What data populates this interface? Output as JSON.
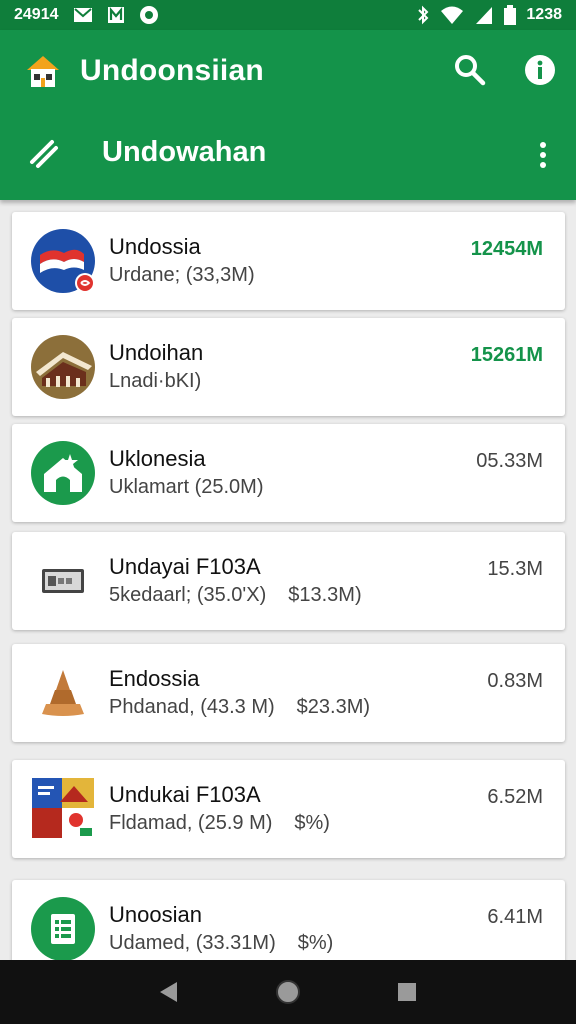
{
  "status_bar": {
    "time_left": "24914",
    "time_right": "1238",
    "icons": [
      "mail-icon",
      "notification-icon",
      "record-icon",
      "bluetooth-icon",
      "wifi-icon",
      "signal-icon",
      "battery-icon"
    ]
  },
  "app_bar": {
    "title": "Undoonsiian",
    "subtitle": "Undowahan",
    "colors": {
      "primary": "#14934a",
      "status": "#0f7e3b"
    }
  },
  "items": [
    {
      "name": "Undossia",
      "detail": "Urdane; (33,3M)",
      "extra": "",
      "size": "12454M",
      "size_style": "green",
      "icon": "flag-avatar-icon"
    },
    {
      "name": "Undoihan",
      "detail": "Lnadi·bKI)",
      "extra": "",
      "size": "15261M",
      "size_style": "green",
      "icon": "building-avatar-icon"
    },
    {
      "name": "Uklonesia",
      "detail": "Uklamart (25.0M)",
      "extra": "",
      "size": "05.33M",
      "size_style": "gray",
      "icon": "house-avatar-icon"
    },
    {
      "name": "Undayai F103A",
      "detail": "5kedaarl; (35.0'X)",
      "extra": "$13.3M)",
      "size": "15.3M",
      "size_style": "gray",
      "icon": "device-icon"
    },
    {
      "name": "Endossia",
      "detail": "Phdanad, (43.3 M)",
      "extra": "$23.3M)",
      "size": "0.83M",
      "size_style": "gray",
      "icon": "pagoda-icon"
    },
    {
      "name": "Undukai F103A",
      "detail": "Fldamad, (25.9 M)",
      "extra": "$%)",
      "size": "6.52M",
      "size_style": "gray",
      "icon": "collage-icon"
    },
    {
      "name": "Unoosian",
      "detail": "Udamed, (33.31M)",
      "extra": "$%)",
      "size": "6.41M",
      "size_style": "gray",
      "icon": "sheet-avatar-icon"
    }
  ]
}
